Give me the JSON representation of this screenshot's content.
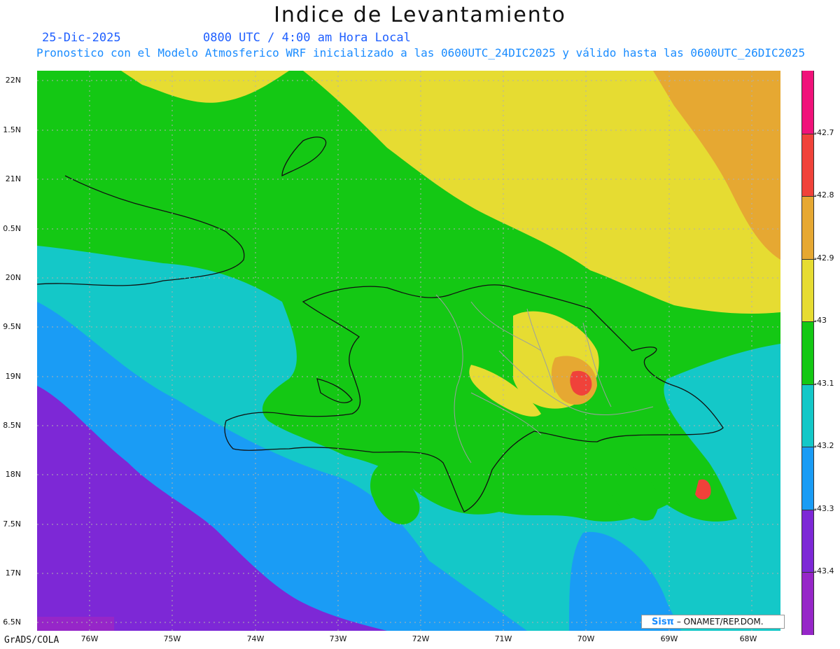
{
  "title": "Indice de Levantamiento",
  "date": "25-Dic-2025",
  "time_line": "0800 UTC / 4:00 am Hora Local",
  "subtitle": "Pronostico con el Modelo Atmosferico WRF inicializado a las 0600UTC_24DIC2025 y válido hasta las  0600UTC_26DIC2025",
  "lat_labels": [
    "22N",
    "1.5N",
    "21N",
    "0.5N",
    "20N",
    "9.5N",
    "19N",
    "8.5N",
    "18N",
    "7.5N",
    "17N",
    "6.5N"
  ],
  "lon_labels": [
    "76W",
    "75W",
    "74W",
    "73W",
    "72W",
    "71W",
    "70W",
    "69W",
    "68W"
  ],
  "colorbar": {
    "labels": [
      "-42.7",
      "-42.8",
      "-42.9",
      "-43",
      "-43.1",
      "-43.2",
      "-43.3",
      "-43.4"
    ],
    "colors": [
      "#f0127a",
      "#f0423a",
      "#e6a832",
      "#e6dc32",
      "#14c814",
      "#14c8c8",
      "#1a9cf5",
      "#7d28d6",
      "#9626c8"
    ]
  },
  "footer": "GrADS/COLA",
  "logo_brand": "Sisπ",
  "logo_text": "– ONAMET/REP.DOM."
}
